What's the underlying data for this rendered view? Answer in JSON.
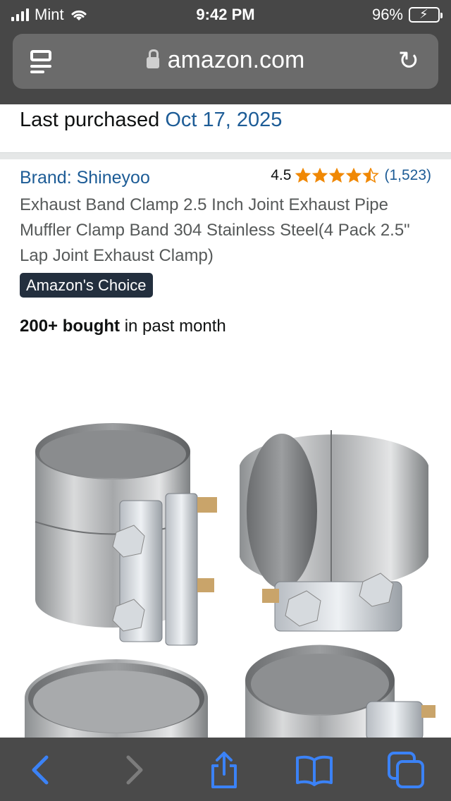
{
  "status_bar": {
    "carrier": "Mint",
    "time": "9:42 PM",
    "battery": "96%"
  },
  "browser": {
    "domain": "amazon.com"
  },
  "purchase": {
    "label": "Last purchased",
    "date": "Oct 17, 2025"
  },
  "product": {
    "brand": "Brand: Shineyoo",
    "rating": "4.5",
    "stars_value": 4.5,
    "review_count": "(1,523)",
    "title": "Exhaust Band Clamp 2.5 Inch Joint Exhaust Pipe Muffler Clamp Band 304 Stainless Steel(4 Pack 2.5\" Lap Joint Exhaust Clamp)",
    "badge": "Amazon's Choice",
    "bought_bold": "200+ bought",
    "bought_rest": " in past month"
  },
  "colors": {
    "link": "#1d5c96",
    "star": "#f08804",
    "badge_bg": "#232f3e",
    "chrome": "#474747",
    "toolbar_icon": "#3b82f6"
  },
  "icons": {
    "reader": "reader-mode-icon",
    "lock": "lock-icon",
    "reload": "reload-icon",
    "back": "back-chevron-icon",
    "forward": "forward-chevron-icon",
    "share": "share-icon",
    "bookmarks": "book-icon",
    "tabs": "tabs-icon"
  }
}
